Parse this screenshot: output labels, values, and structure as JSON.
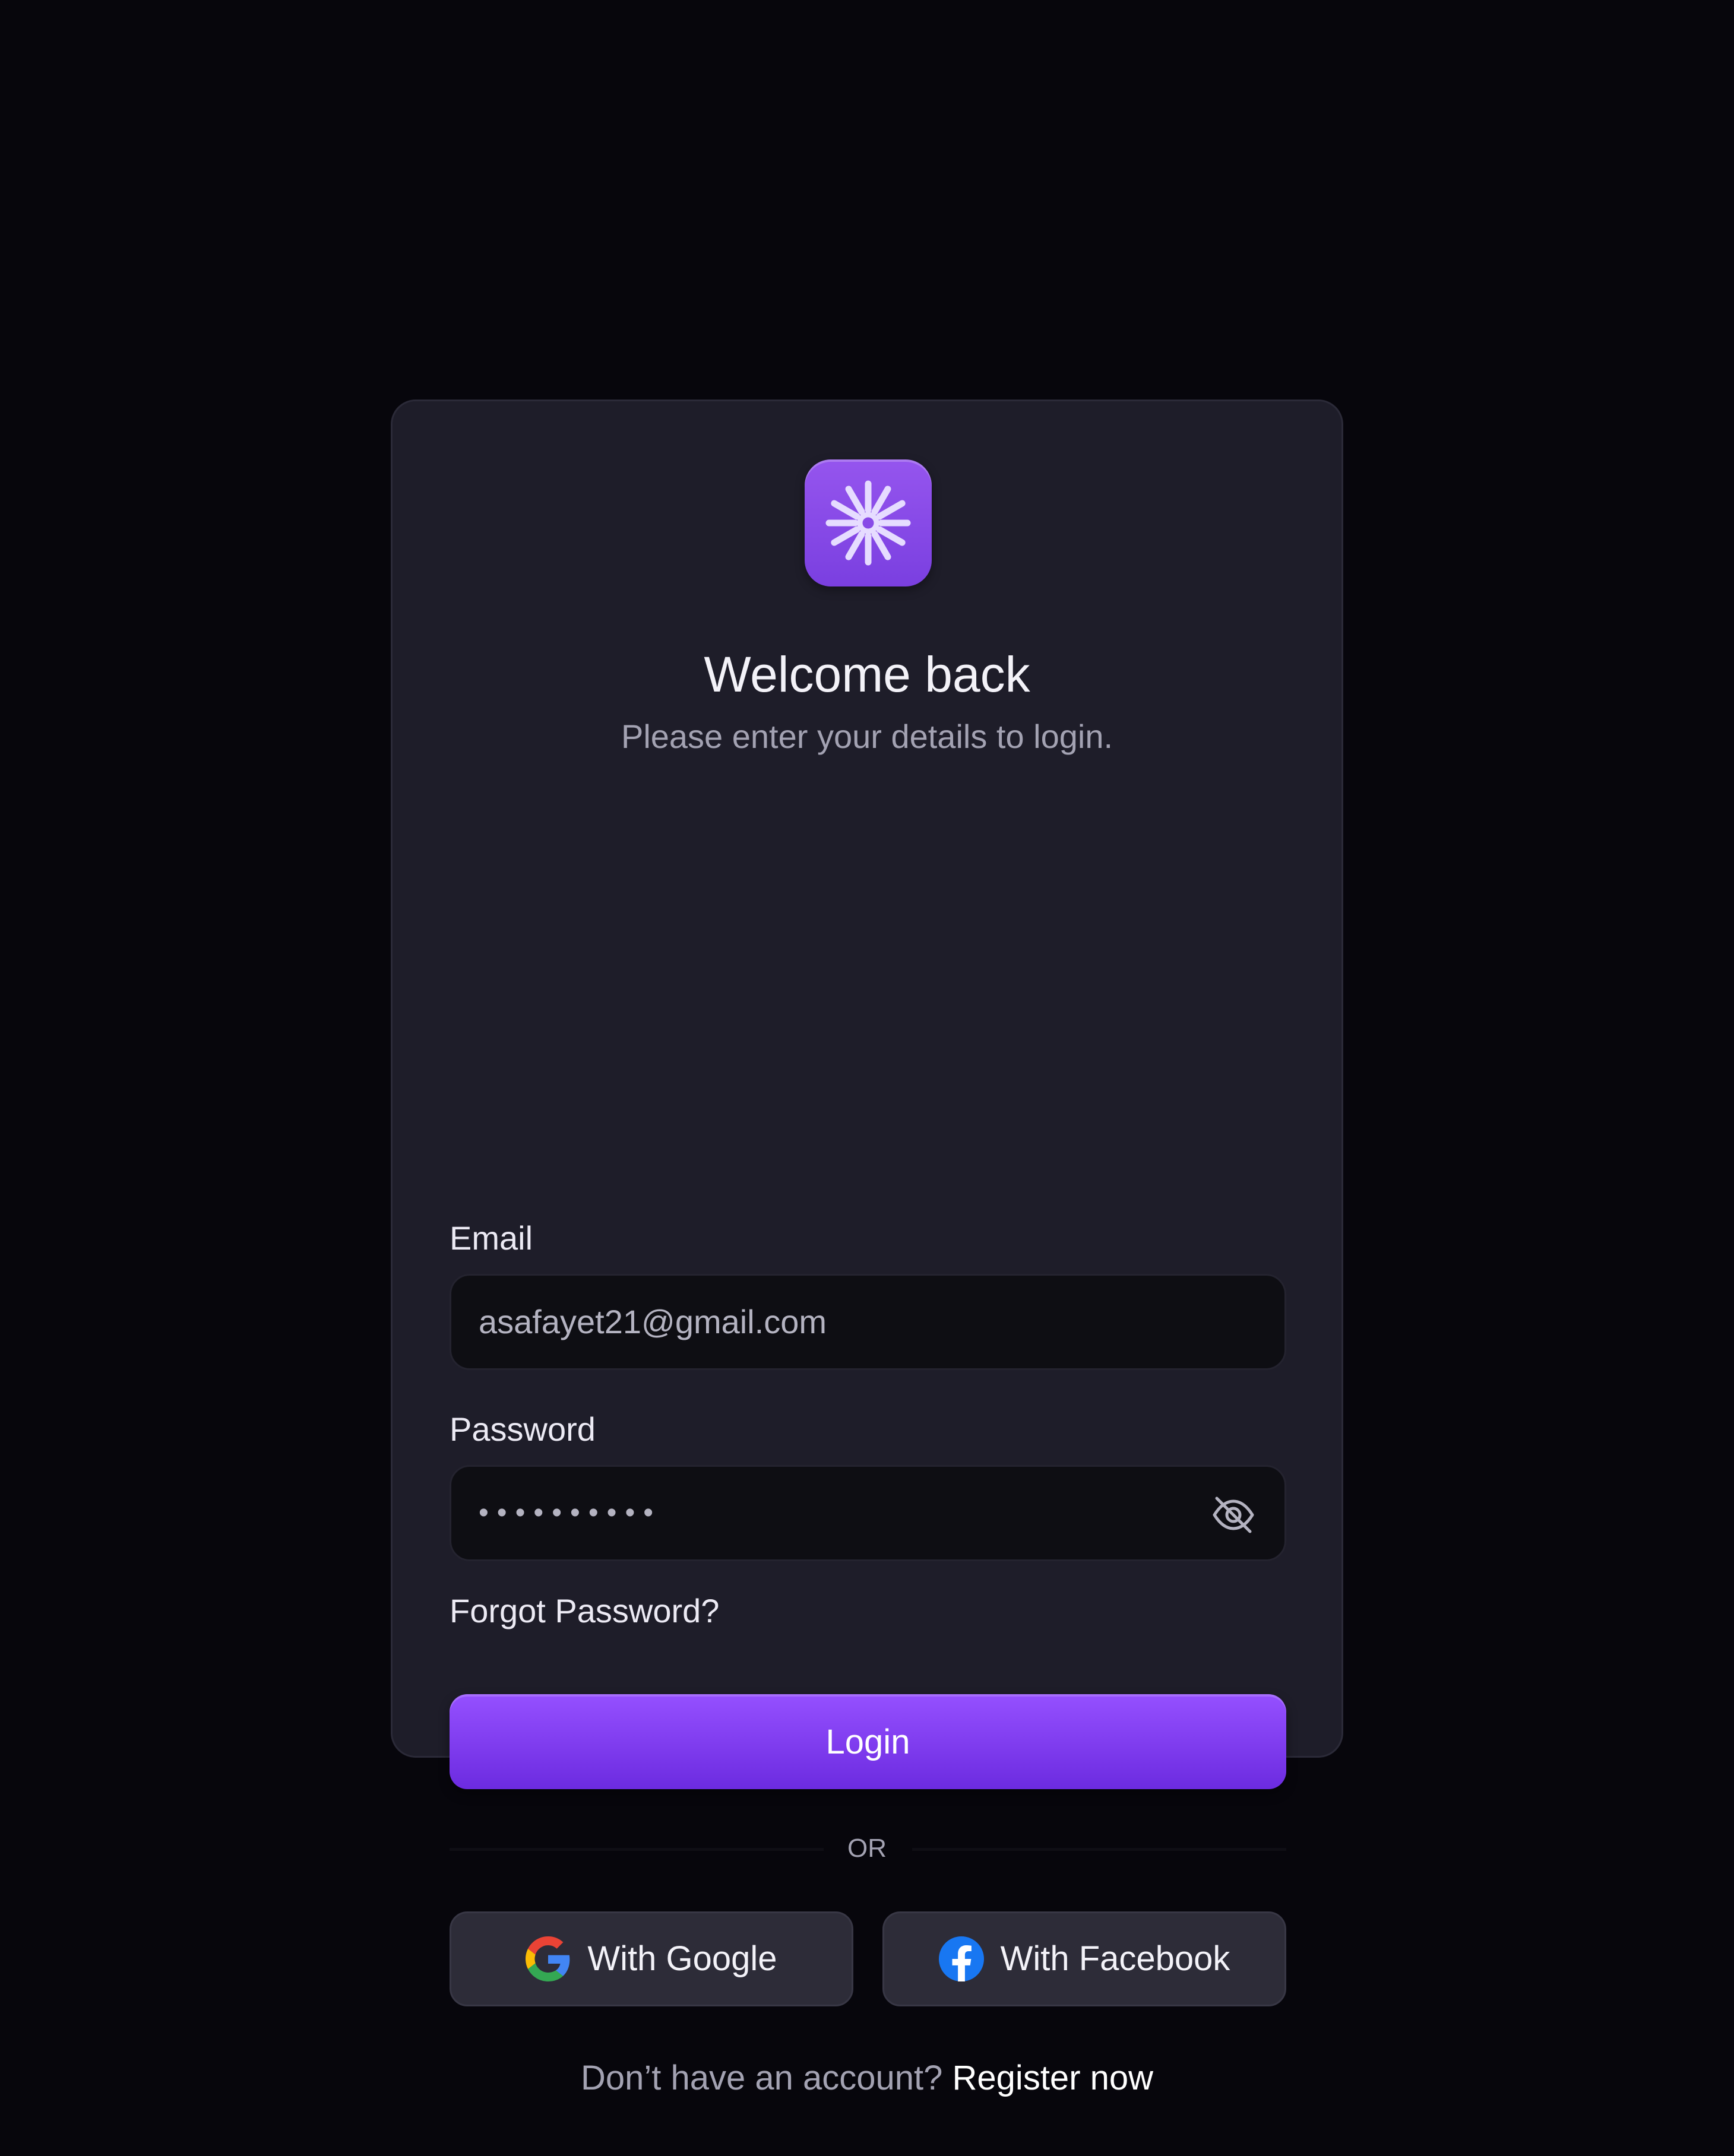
{
  "header": {
    "logo_icon": "asterisk-burst-icon",
    "title": "Welcome back",
    "subtitle": "Please enter your details to login."
  },
  "form": {
    "email_label": "Email",
    "email_value": "asafayet21@gmail.com",
    "password_label": "Password",
    "password_mask": "••••••••••",
    "visibility_icon": "eye-off-icon",
    "forgot_password": "Forgot Password?",
    "login_label": "Login"
  },
  "divider": {
    "label": "OR"
  },
  "social": {
    "google_label": "With Google",
    "google_icon": "google-icon",
    "facebook_label": "With Facebook",
    "facebook_icon": "facebook-icon"
  },
  "footer": {
    "prompt": "Don’t have an account?",
    "link": "Register now"
  },
  "colors": {
    "background": "#07060c",
    "card": "#1e1d29",
    "accent": "#8a4af5",
    "input": "#0e0e13",
    "social_button": "#2d2c38"
  }
}
